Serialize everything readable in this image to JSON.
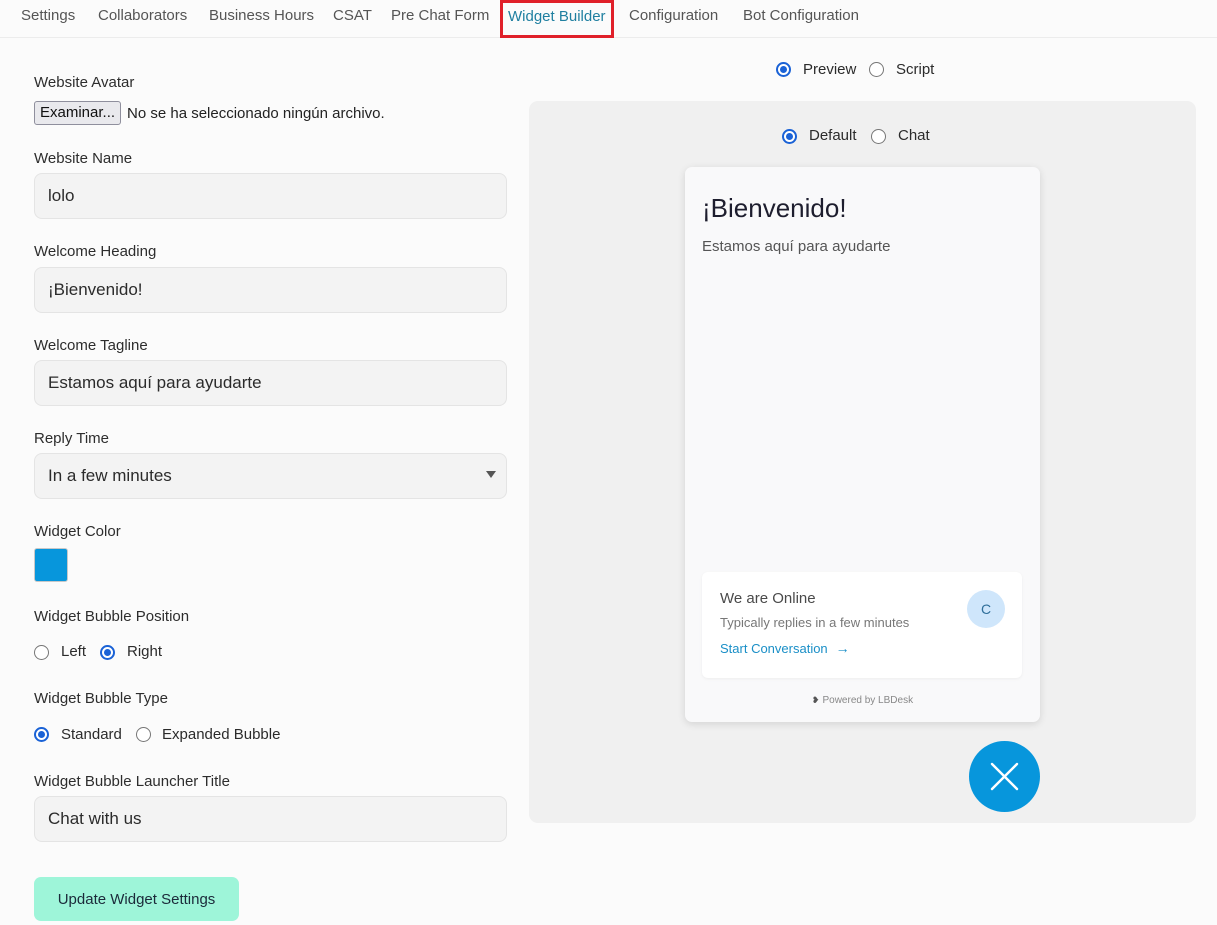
{
  "tabs": [
    {
      "label": "Settings"
    },
    {
      "label": "Collaborators"
    },
    {
      "label": "Business Hours"
    },
    {
      "label": "CSAT"
    },
    {
      "label": "Pre Chat Form"
    },
    {
      "label": "Widget Builder",
      "active": true
    },
    {
      "label": "Configuration"
    },
    {
      "label": "Bot Configuration"
    }
  ],
  "form": {
    "avatar_label": "Website Avatar",
    "file_button": "Examinar...",
    "file_status": "No se ha seleccionado ningún archivo.",
    "name_label": "Website Name",
    "name_value": "lolo",
    "heading_label": "Welcome Heading",
    "heading_value": "¡Bienvenido!",
    "tagline_label": "Welcome Tagline",
    "tagline_value": "Estamos aquí para ayudarte",
    "reply_label": "Reply Time",
    "reply_value": "In a few minutes",
    "color_label": "Widget Color",
    "widget_color": "#0796dc",
    "position_label": "Widget Bubble Position",
    "position_left": "Left",
    "position_right": "Right",
    "position_selected": "Right",
    "type_label": "Widget Bubble Type",
    "type_standard": "Standard",
    "type_expanded": "Expanded Bubble",
    "type_selected": "Standard",
    "launcher_label": "Widget Bubble Launcher Title",
    "launcher_value": "Chat with us",
    "update_button": "Update Widget Settings"
  },
  "preview": {
    "mode_preview": "Preview",
    "mode_script": "Script",
    "mode_selected": "Preview",
    "view_default": "Default",
    "view_chat": "Chat",
    "view_selected": "Default",
    "card_heading": "¡Bienvenido!",
    "card_tagline": "Estamos aquí para ayudarte",
    "online_title": "We are Online",
    "online_sub": "Typically replies in a few minutes",
    "start_link": "Start Conversation",
    "avatar_letter": "C",
    "powered_by": "Powered by LBDesk"
  }
}
